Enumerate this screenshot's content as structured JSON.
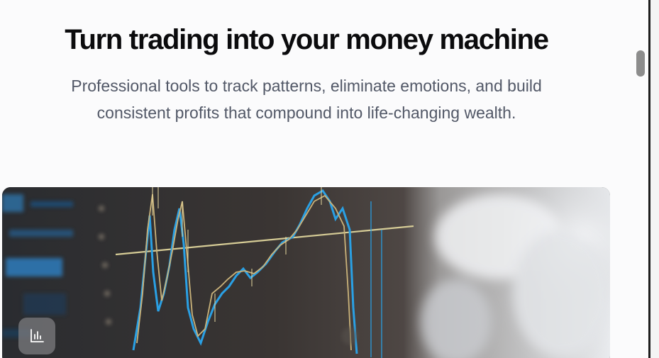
{
  "hero": {
    "title": "Turn trading into your money machine",
    "subtitle_line1": "Professional tools to track patterns, eliminate emotions, and build",
    "subtitle_line2": "consistent profits that compound into life-changing wealth."
  },
  "image": {
    "label": "trading-chart-photo",
    "badge_icon": "bar-chart-icon"
  },
  "colors": {
    "title": "#0b0b0d",
    "subtitle": "#525867",
    "background": "#fbfbfc",
    "chart_blue": "#2aa0e4",
    "chart_gold": "#c9b27a"
  }
}
